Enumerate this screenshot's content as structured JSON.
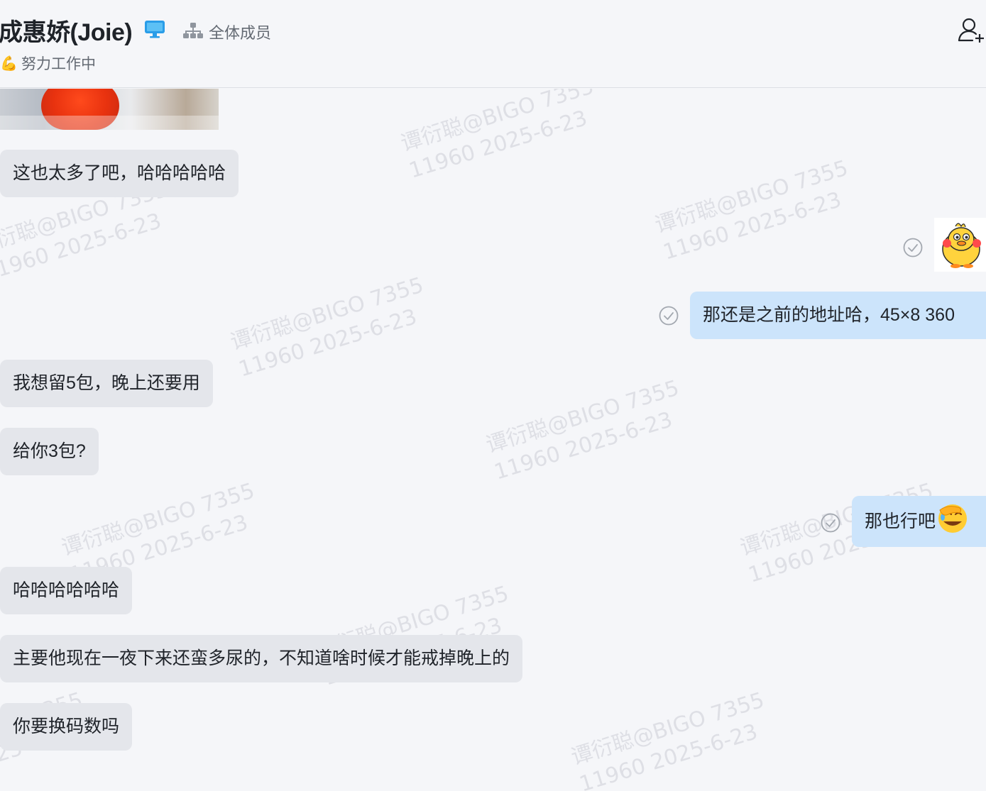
{
  "header": {
    "contact_name": "成惠娇(Joie)",
    "org_label": "全体成员",
    "status_emoji": "💪",
    "status_text": "努力工作中"
  },
  "watermark": {
    "line1": "谭衍聪@BIGO 7355",
    "line2": "11960 2025-6-23"
  },
  "messages": [
    {
      "side": "in",
      "text": "这也太多了吧，哈哈哈哈哈"
    },
    {
      "side": "out",
      "text": "那还是之前的地址哈，45×8 360"
    },
    {
      "side": "in",
      "text": "我想留5包，晚上还要用"
    },
    {
      "side": "in",
      "text": "给你3包?"
    },
    {
      "side": "out",
      "text": "那也行吧"
    },
    {
      "side": "in",
      "text": "哈哈哈哈哈哈"
    },
    {
      "side": "in",
      "text": "主要他现在一夜下来还蛮多尿的，不知道啥时候才能戒掉晚上的"
    },
    {
      "side": "in",
      "text": "你要换码数吗"
    }
  ],
  "icons": {
    "device": "monitor-icon",
    "org": "org-chart-icon",
    "add_member": "add-member-icon",
    "read_status": "read-check-icon",
    "sticker": "duck-sticker",
    "emoji": "facepalm-laugh-emoji"
  },
  "colors": {
    "background": "#f5f6f9",
    "incoming_bubble": "#e4e6eb",
    "outgoing_bubble": "#cce4fb",
    "monitor_icon": "#2a9de8"
  }
}
